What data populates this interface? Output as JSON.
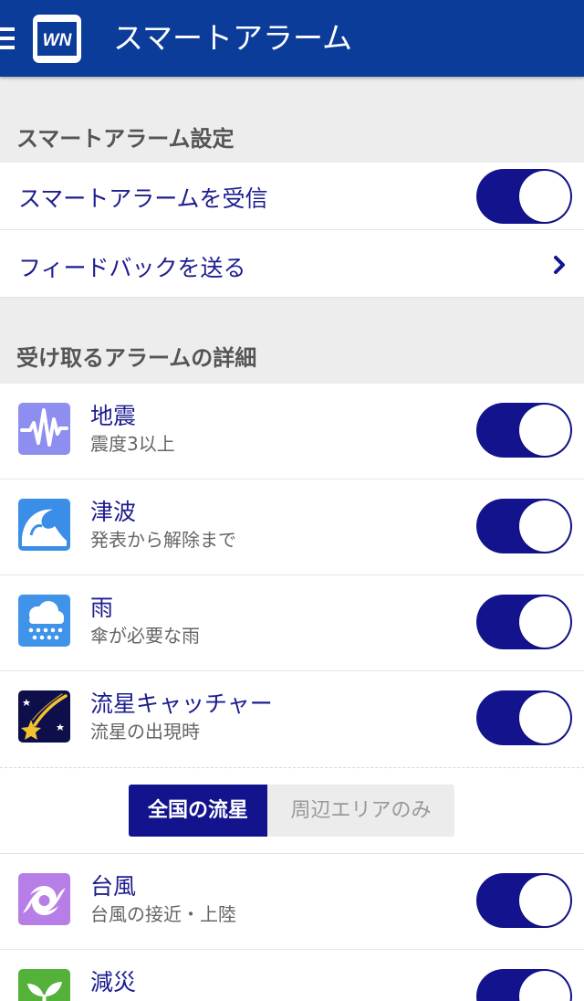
{
  "header": {
    "title": "スマートアラーム",
    "logo_text": "WN",
    "menu_icon": "hamburger-icon",
    "background": "#0b3c9a"
  },
  "sections": {
    "settings_title": "スマートアラーム設定",
    "details_title": "受け取るアラームの詳細"
  },
  "settings": {
    "receive_label": "スマートアラームを受信",
    "receive_enabled": true,
    "feedback_label": "フィードバックを送る"
  },
  "alarms": [
    {
      "title": "地震",
      "sub": "震度3以上",
      "icon": "earthquake-icon",
      "enabled": true
    },
    {
      "title": "津波",
      "sub": "発表から解除まで",
      "icon": "tsunami-icon",
      "enabled": true
    },
    {
      "title": "雨",
      "sub": "傘が必要な雨",
      "icon": "rain-icon",
      "enabled": true
    },
    {
      "title": "流星キャッチャー",
      "sub": "流星の出現時",
      "icon": "meteor-icon",
      "enabled": true
    },
    {
      "title": "台風",
      "sub": "台風の接近・上陸",
      "icon": "typhoon-icon",
      "enabled": true
    },
    {
      "title": "減災",
      "sub": "",
      "icon": "sprout-icon",
      "enabled": true
    }
  ],
  "meteor_scope": {
    "options": [
      "全国の流星",
      "周辺エリアのみ"
    ],
    "selected": "全国の流星"
  },
  "colors": {
    "accent": "#13138e",
    "toggle_on": "#13138e",
    "section_bg": "#ededed"
  }
}
